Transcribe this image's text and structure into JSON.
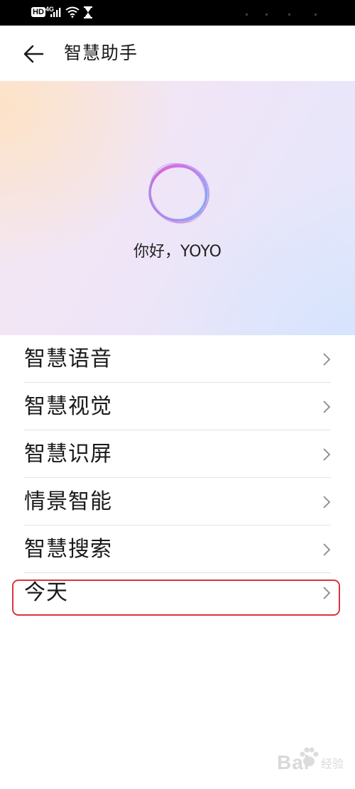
{
  "status_bar": {
    "hd_badge": "HD",
    "network": "4G",
    "icons": [
      "signal-icon",
      "wifi-icon",
      "hourglass-icon"
    ]
  },
  "app_bar": {
    "back_icon": "back-arrow-icon",
    "title": "智慧助手"
  },
  "hero": {
    "logo_icon": "voice-assistant-ring-icon",
    "greeting": "你好，YOYO"
  },
  "menu": {
    "items": [
      {
        "label": "智慧语音",
        "icon": "chevron-right-icon"
      },
      {
        "label": "智慧视觉",
        "icon": "chevron-right-icon"
      },
      {
        "label": "智慧识屏",
        "icon": "chevron-right-icon"
      },
      {
        "label": "情景智能",
        "icon": "chevron-right-icon"
      },
      {
        "label": "智慧搜索",
        "icon": "chevron-right-icon"
      },
      {
        "label": "今天",
        "icon": "chevron-right-icon",
        "highlighted": true
      }
    ]
  },
  "watermark": {
    "text": "Bai",
    "sub": "经验"
  },
  "colors": {
    "highlight_border": "#d9363e",
    "divider": "#e3e3e3",
    "status_bar": "#000000"
  }
}
